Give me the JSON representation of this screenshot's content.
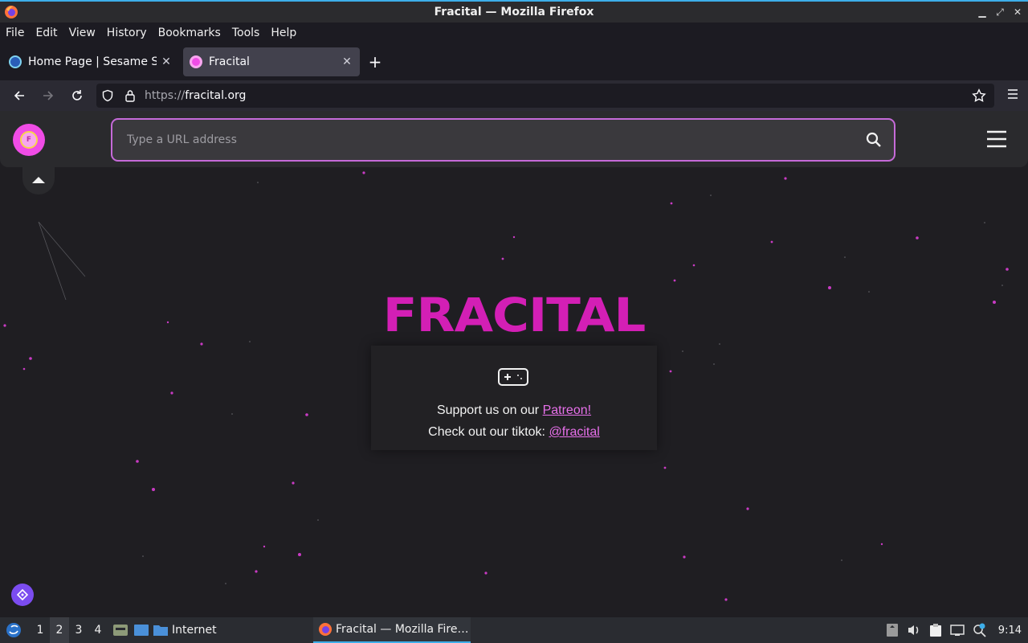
{
  "window": {
    "title": "Fracital — Mozilla Firefox"
  },
  "menubar": {
    "items": [
      "File",
      "Edit",
      "View",
      "History",
      "Bookmarks",
      "Tools",
      "Help"
    ]
  },
  "tabs": [
    {
      "label": "Home Page | Sesame Street",
      "active": false
    },
    {
      "label": "Fracital",
      "active": true
    }
  ],
  "navbar": {
    "url_protocol": "https://",
    "url_host": "fracital.org"
  },
  "site": {
    "search_placeholder": "Type a URL address",
    "brand": "FRACITAL",
    "support_text": "Support us on our ",
    "support_link": "Patreon!",
    "tiktok_text": "Check out our tiktok: ",
    "tiktok_link": "@fracital",
    "accent": "#d31fb5",
    "link_color": "#e770ea"
  },
  "taskbar": {
    "workspaces": [
      "1",
      "2",
      "3",
      "4"
    ],
    "current_workspace": "2",
    "launcher_label": "Internet",
    "task_label": "Fracital — Mozilla Fire…",
    "clock": "9:14"
  }
}
